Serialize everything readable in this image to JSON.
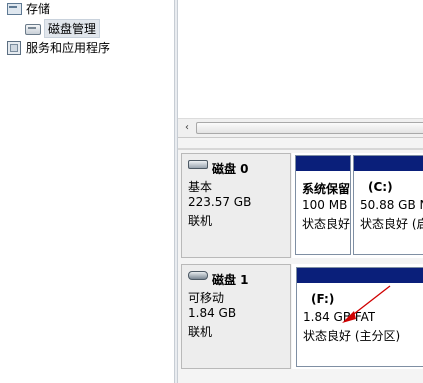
{
  "tree": {
    "items": [
      {
        "label": "存储",
        "icon": "storage-icon"
      },
      {
        "label": "磁盘管理",
        "icon": "disk-management-icon",
        "selected": true
      },
      {
        "label": "服务和应用程序",
        "icon": "services-applications-icon"
      }
    ]
  },
  "scrollbar": {
    "left_arrow": "‹"
  },
  "disks": [
    {
      "title": "磁盘 0",
      "type": "基本",
      "size": "223.57 GB",
      "status": "联机",
      "partitions": [
        {
          "name": "系统保留",
          "size": "100 MB",
          "status": "状态良好"
        },
        {
          "name": "(C:)",
          "size": "50.88 GB N",
          "status": "状态良好 (启"
        }
      ]
    },
    {
      "title": "磁盘 1",
      "type": "可移动",
      "size": "1.84 GB",
      "status": "联机",
      "partitions": [
        {
          "name": "(F:)",
          "size": "1.84 GB FAT",
          "status": "状态良好 (主分区)"
        }
      ]
    }
  ],
  "colors": {
    "partition_bar": "#0a1f7a",
    "annotation_arrow": "#d00000"
  }
}
